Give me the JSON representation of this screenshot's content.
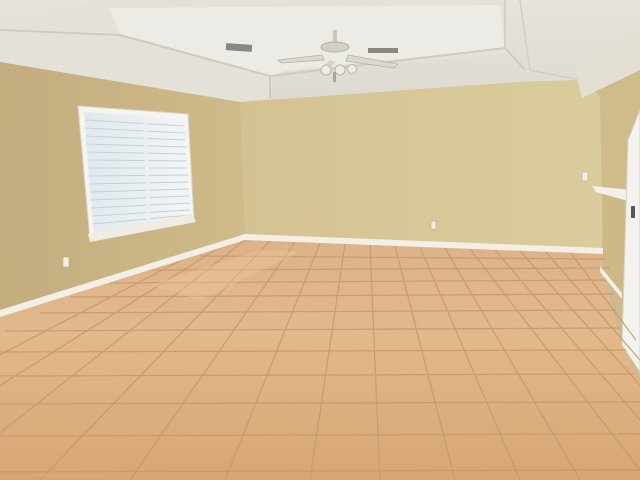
{
  "scene": {
    "subject": "empty-room",
    "palette": {
      "ceiling": "#e9e6df",
      "ceiling_tray": "#f1efe9",
      "wall_left": "#cdb889",
      "wall_back": "#d8c796",
      "wall_right": "#d2be8c",
      "floor_light": "#e3ba8f",
      "floor_dark": "#c98f5f",
      "grout": "#b88e62",
      "baseboard": "#f3efe6",
      "window_blind": "#e7edf0",
      "door_white": "#f4f2ee"
    },
    "icons": [
      "ceiling-fan-icon",
      "air-vent-icon",
      "electrical-outlet-icon",
      "window-blinds-icon"
    ]
  }
}
